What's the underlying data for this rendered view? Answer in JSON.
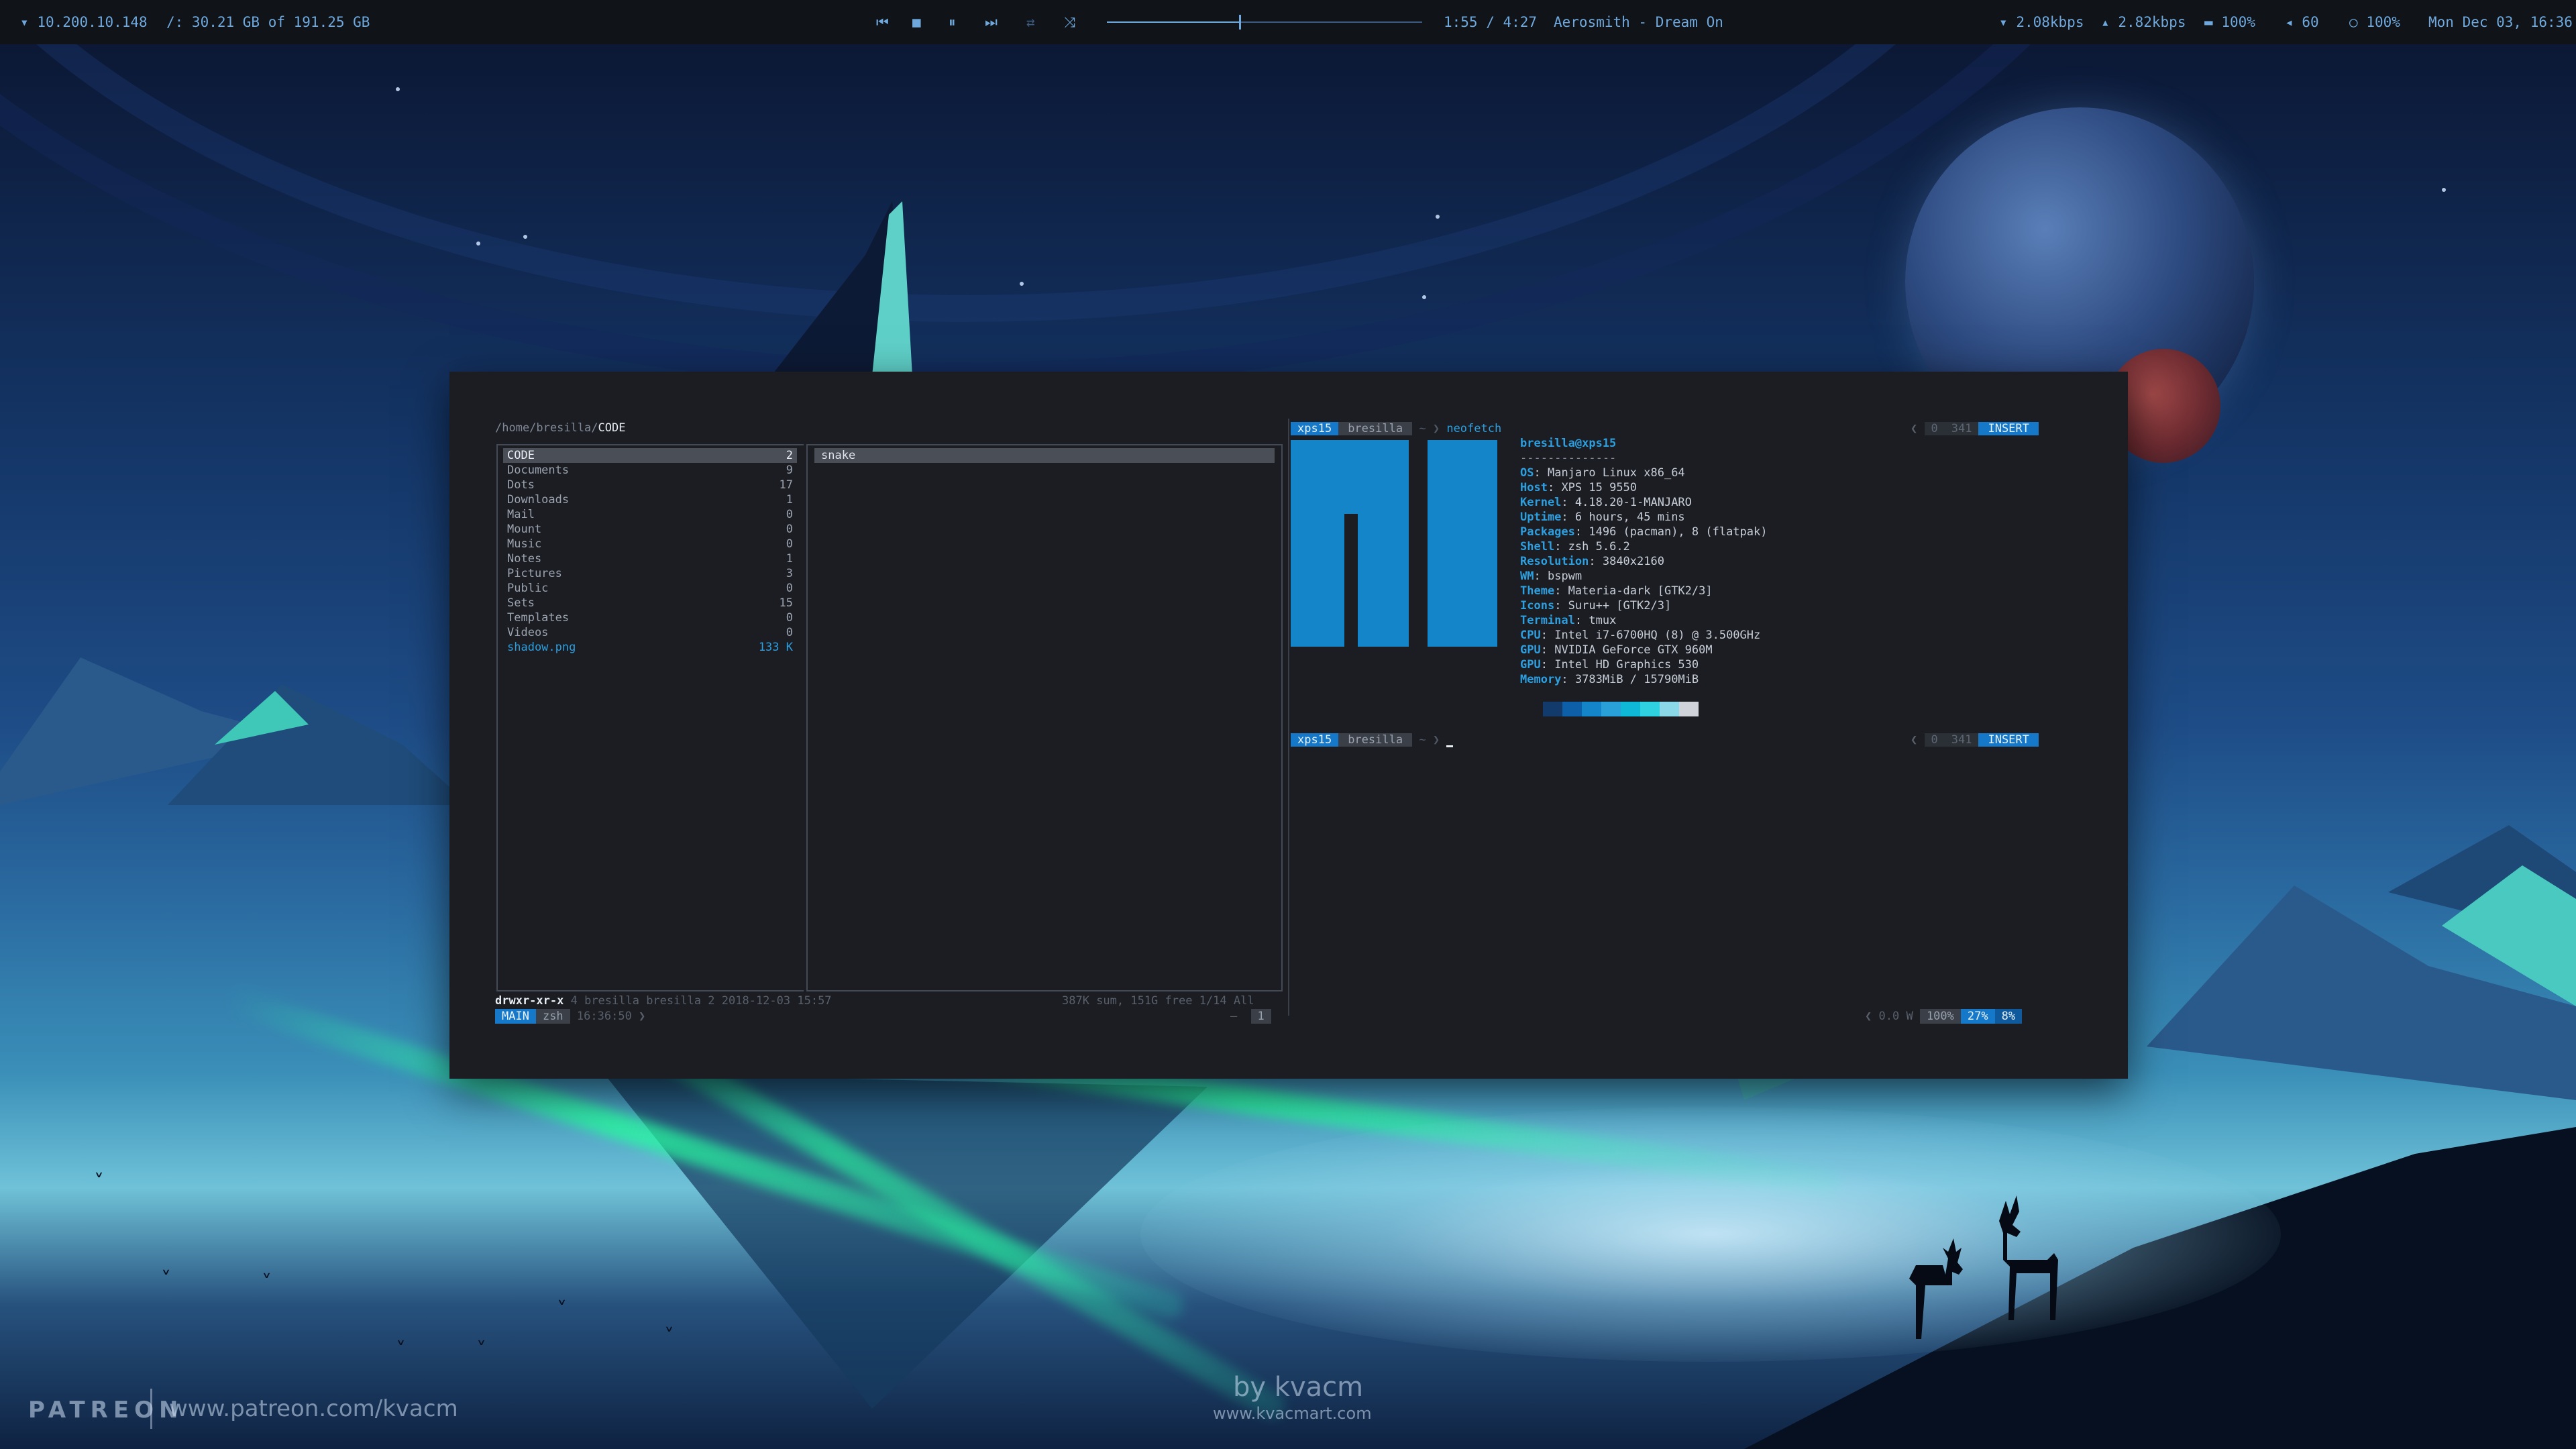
{
  "topbar": {
    "ip": "10.200.10.148",
    "disk": "/: 30.21 GB of 191.25 GB",
    "media_controls": [
      "prev-icon",
      "stop-icon",
      "pause-icon",
      "next-icon",
      "repeat-icon",
      "shuffle-icon"
    ],
    "track_progress": 0.42,
    "time": "1:55 / 4:27",
    "song": "Aerosmith - Dream On",
    "down_speed": "2.08kbps",
    "up_speed": "2.82kbps",
    "battery": "100%",
    "volume": "60",
    "brightness": "100%",
    "clock": "Mon Dec 03, 16:36"
  },
  "ranger": {
    "path_prefix": "/home/bresilla/",
    "path_current": "CODE",
    "files": [
      {
        "name": "CODE",
        "count": "2",
        "selected": true
      },
      {
        "name": "Documents",
        "count": "9"
      },
      {
        "name": "Dots",
        "count": "17"
      },
      {
        "name": "Downloads",
        "count": "1"
      },
      {
        "name": "Mail",
        "count": "0"
      },
      {
        "name": "Mount",
        "count": "0"
      },
      {
        "name": "Music",
        "count": "0"
      },
      {
        "name": "Notes",
        "count": "1"
      },
      {
        "name": "Pictures",
        "count": "3"
      },
      {
        "name": "Public",
        "count": "0"
      },
      {
        "name": "Sets",
        "count": "15"
      },
      {
        "name": "Templates",
        "count": "0"
      },
      {
        "name": "Videos",
        "count": "0"
      },
      {
        "name": "shadow.png",
        "count": "133 K",
        "file": true
      }
    ],
    "preview_item": "snake",
    "status_perm": "drwxr-xr-x",
    "status_meta": "4 bresilla bresilla 2 2018-12-03 15:57",
    "status_right": "387K sum, 151G free  1/14  All"
  },
  "tmux": {
    "session": "MAIN",
    "window": "zsh",
    "time": "16:36:50",
    "dash": "–",
    "pane_num": "1",
    "power": "0.0 W",
    "battery": "100%",
    "cpu": "27%",
    "mem": "8%"
  },
  "zsh": {
    "host": "xps15",
    "user": "bresilla",
    "dir": "~",
    "command": "neofetch",
    "rprompt_num": "0",
    "rprompt_hist": "341",
    "mode": "INSERT"
  },
  "neofetch": {
    "title": "bresilla@xps15",
    "separator": "--------------",
    "info": [
      {
        "key": "OS",
        "value": "Manjaro Linux x86_64"
      },
      {
        "key": "Host",
        "value": "XPS 15 9550"
      },
      {
        "key": "Kernel",
        "value": "4.18.20-1-MANJARO"
      },
      {
        "key": "Uptime",
        "value": "6 hours, 45 mins"
      },
      {
        "key": "Packages",
        "value": "1496 (pacman), 8 (flatpak)"
      },
      {
        "key": "Shell",
        "value": "zsh 5.6.2"
      },
      {
        "key": "Resolution",
        "value": "3840x2160"
      },
      {
        "key": "WM",
        "value": "bspwm"
      },
      {
        "key": "Theme",
        "value": "Materia-dark [GTK2/3]"
      },
      {
        "key": "Icons",
        "value": "Suru++ [GTK2/3]"
      },
      {
        "key": "Terminal",
        "value": "tmux"
      },
      {
        "key": "CPU",
        "value": "Intel i7-6700HQ (8) @ 3.500GHz"
      },
      {
        "key": "GPU",
        "value": "NVIDIA GeForce GTX 960M"
      },
      {
        "key": "GPU",
        "value": "Intel HD Graphics 530"
      },
      {
        "key": "Memory",
        "value": "3783MiB / 15790MiB"
      }
    ],
    "palette": [
      "#123a6a",
      "#0d5fa8",
      "#1585c9",
      "#2aa0d8",
      "#10b8d8",
      "#2fd0e0",
      "#8ad8e8",
      "#d0d4da"
    ]
  },
  "watermark": {
    "brand": "PATREON",
    "url": "www.patreon.com/kvacm",
    "by": "by kvacm",
    "site": "www.kvacmart.com"
  }
}
